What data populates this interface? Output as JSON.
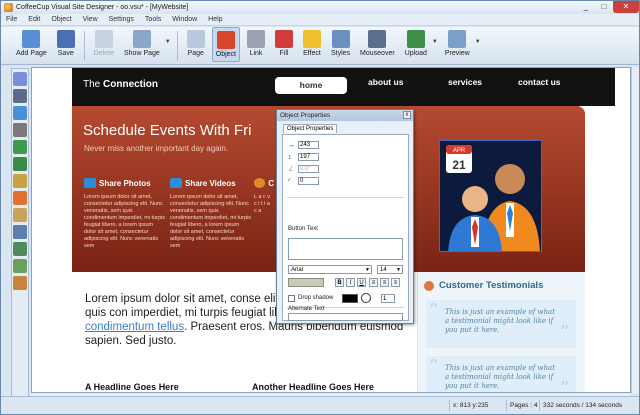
{
  "window": {
    "title": "CoffeeCup Visual Site Designer - oo.vsu* - [MyWebsite]",
    "controls": [
      "_",
      "□",
      "✕"
    ]
  },
  "menu": [
    "File",
    "Edit",
    "Object",
    "View",
    "Settings",
    "Tools",
    "Window",
    "Help"
  ],
  "toolbar": [
    {
      "label": "Add Page",
      "icon": "add-page-icon",
      "color": "#5a8fd6"
    },
    {
      "label": "Save",
      "icon": "save-icon",
      "color": "#4a6fb5"
    },
    {
      "label": "Delete",
      "icon": "delete-icon",
      "color": "#c8d3e0",
      "disabled": true
    },
    {
      "label": "Show Page",
      "icon": "show-page-icon",
      "color": "#8aa7c9",
      "dropdown": true
    },
    {
      "label": "Page",
      "icon": "page-icon",
      "color": "#b8c9dd"
    },
    {
      "label": "Object",
      "icon": "object-icon",
      "color": "#d9472b",
      "active": true
    },
    {
      "label": "Link",
      "icon": "link-icon",
      "color": "#9aa4b0"
    },
    {
      "label": "Fill",
      "icon": "fill-icon",
      "color": "#d23b3b"
    },
    {
      "label": "Effect",
      "icon": "effect-icon",
      "color": "#f0c030"
    },
    {
      "label": "Styles",
      "icon": "styles-icon",
      "color": "#6c8fc2"
    },
    {
      "label": "Mouseover",
      "icon": "mouseover-icon",
      "color": "#5a6f8a"
    },
    {
      "label": "Upload",
      "icon": "upload-icon",
      "color": "#3d8f4a",
      "dropdown": true
    },
    {
      "label": "Preview",
      "icon": "preview-icon",
      "color": "#7aa0c8",
      "dropdown": true
    }
  ],
  "left_tools": [
    {
      "name": "select-arrow-icon",
      "color": "#7b8fd6"
    },
    {
      "name": "text-tool-icon",
      "color": "#5b6b8a"
    },
    {
      "name": "shapes-tool-icon",
      "color": "#4a90d9"
    },
    {
      "name": "pencil-tool-icon",
      "color": "#7a7a7a"
    },
    {
      "name": "image-tool-icon",
      "color": "#3f9a4f"
    },
    {
      "name": "line-tool-icon",
      "color": "#3a8a4a"
    },
    {
      "name": "brush-tool-icon",
      "color": "#c9a242"
    },
    {
      "name": "flash-tool-icon",
      "color": "#e07030"
    },
    {
      "name": "form-tool-icon",
      "color": "#c9a45c"
    },
    {
      "name": "embed-tool-icon",
      "color": "#5d7fb0"
    },
    {
      "name": "table-tool-icon",
      "color": "#4f8a5a"
    },
    {
      "name": "widget-tool-icon",
      "color": "#6b9f5c"
    },
    {
      "name": "video-tool-icon",
      "color": "#c9843a"
    }
  ],
  "site": {
    "brand_prefix": "The",
    "brand_name": "Connection",
    "nav": [
      "home",
      "about us",
      "services",
      "contact us"
    ],
    "hero_title": "Schedule Events With Fri",
    "hero_subtitle": "Never miss another important day again.",
    "features": [
      {
        "title": "Share Photos",
        "icon": "photos-icon",
        "color": "#2a8fd6",
        "text": "Lorem ipsum dolor sit amet, consectetur adipiscing elit. Nunc venenatis, sem quis condimentum imperdiet, mi turpis feugiat libero, a lorem ipsum dolor sit amet, consectetur adipiscing elit. Nunc venenatis sem"
      },
      {
        "title": "Share Videos",
        "icon": "videos-icon",
        "color": "#2a8fd6",
        "text": "Lorem ipsum dolor sit amet, consectetur adipiscing elit. Nunc venenatis, sem quis condimentum imperdiet, mi turpis feugiat libero, a lorem ipsum dolor sit amet, consectetur adipiscing elit. Nunc venenatis sem"
      },
      {
        "title": "C",
        "icon": "chat-icon",
        "color": "#e08a2a",
        "text": "L a c v c i t l a c a"
      }
    ],
    "calendar_month": "APR",
    "calendar_day": "21",
    "lorem_main": "Lorem ipsum dolor sit amet, conse elit. Nunc venenatis, sem quis con imperdiet, mi turpis feugiat libero, a varius eros arcu",
    "lorem_link": "condimentum tellus",
    "lorem_tail": ". Praesent eros. Mauris bibendum euismod sapien. Sed justo.",
    "headline_1": "A Headline Goes Here",
    "headline_2": "Another Headline Goes Here",
    "testimonials_title": "Customer Testimonials",
    "testimonial_text": "This is just an example of what a testimonial might look like if you put it here.",
    "quote_open": "“",
    "quote_close": "”"
  },
  "dialog": {
    "title": "Object Properties",
    "close": "x",
    "tab": "Object Properties",
    "width": "243",
    "height": "197",
    "angle": "0.0°",
    "corner": "0",
    "button_text_label": "Button Text",
    "font": "Arial",
    "font_size": "14",
    "format_buttons": [
      "B",
      "I",
      "U",
      "≡",
      "≡",
      "≡"
    ],
    "drop_shadow_label": "Drop shadow",
    "shadow_amount": "1",
    "alt_text_label": "Alternate Text"
  },
  "status": {
    "coords": "x: 813  y:235",
    "pages": "Pages : 4",
    "time": "332 seconds / 134 seconds"
  }
}
